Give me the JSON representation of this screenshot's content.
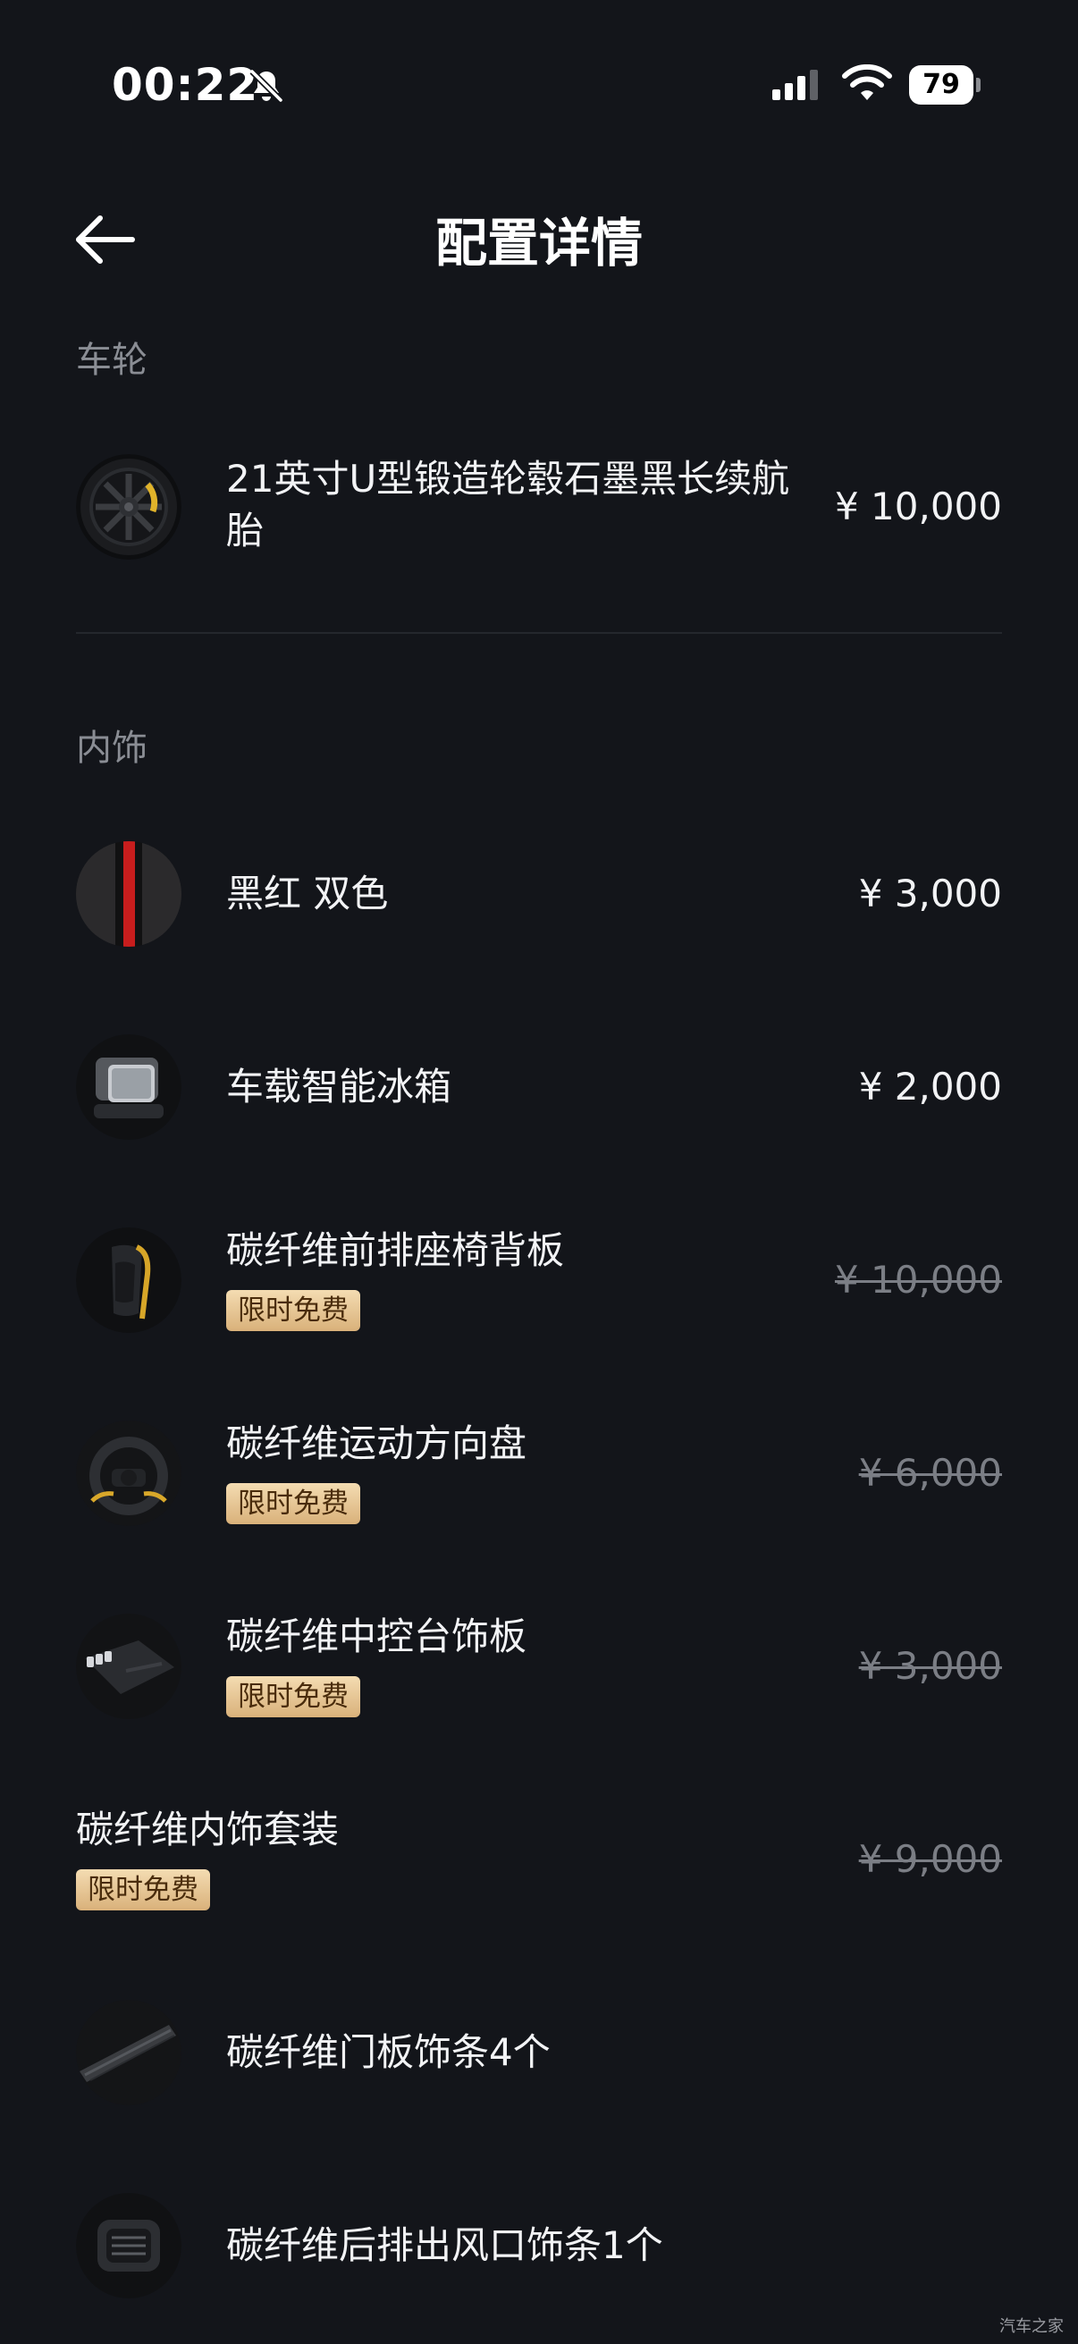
{
  "status_bar": {
    "time": "00:22",
    "battery": "79"
  },
  "header": {
    "title": "配置详情"
  },
  "sections": [
    {
      "title": "车轮",
      "items": [
        {
          "name": "21英寸U型锻造轮毂石墨黑长续航胎",
          "price": "¥ 10,000",
          "thumb": "wheel"
        }
      ]
    },
    {
      "title": "内饰",
      "items": [
        {
          "name": "黑红 双色",
          "price": "¥ 3,000",
          "thumb": "black-red-fabric"
        },
        {
          "name": "车载智能冰箱",
          "price": "¥ 2,000",
          "thumb": "car-fridge"
        },
        {
          "name": "碳纤维前排座椅背板",
          "price": "¥ 10,000",
          "badge": "限时免费",
          "thumb": "seat-back"
        },
        {
          "name": "碳纤维运动方向盘",
          "price": "¥ 6,000",
          "badge": "限时免费",
          "thumb": "steering-wheel"
        },
        {
          "name": "碳纤维中控台饰板",
          "price": "¥ 3,000",
          "badge": "限时免费",
          "thumb": "center-console"
        },
        {
          "name": "碳纤维内饰套装",
          "price": "¥ 9,000",
          "badge": "限时免费"
        },
        {
          "name": "碳纤维门板饰条4个",
          "thumb": "door-trim"
        },
        {
          "name": "碳纤维后排出风口饰条1个",
          "thumb": "rear-air-vent"
        }
      ]
    }
  ],
  "watermark": "汽车之家",
  "colors": {
    "background": "#13151a",
    "badge_gold": "#e8c694",
    "muted_text": "#8a8d94"
  }
}
